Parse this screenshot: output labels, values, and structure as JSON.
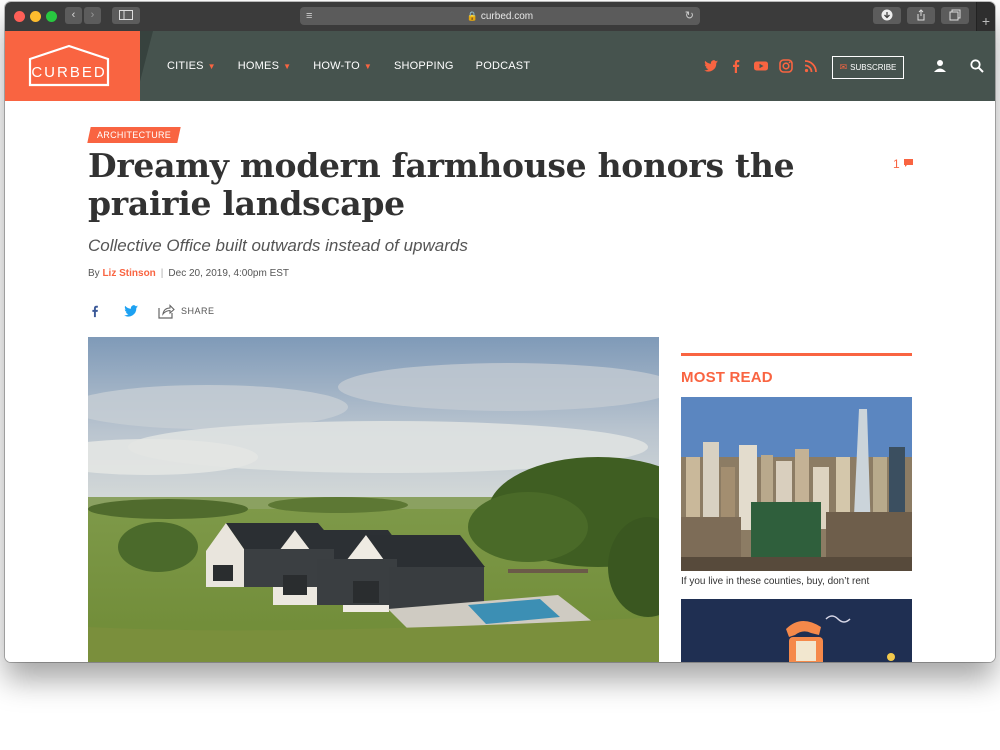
{
  "browser": {
    "url": "curbed.com",
    "lock_icon": "lock-icon"
  },
  "site": {
    "logo_text": "CURBED",
    "brand_color": "#f96441",
    "header_color": "#46534e",
    "nav": [
      {
        "label": "CITIES",
        "has_dropdown": true
      },
      {
        "label": "HOMES",
        "has_dropdown": true
      },
      {
        "label": "HOW-TO",
        "has_dropdown": true
      },
      {
        "label": "SHOPPING",
        "has_dropdown": false
      },
      {
        "label": "PODCAST",
        "has_dropdown": false
      }
    ],
    "social_icons": [
      "twitter-icon",
      "facebook-icon",
      "youtube-icon",
      "instagram-icon",
      "rss-icon"
    ],
    "subscribe_label": "SUBSCRIBE"
  },
  "article": {
    "tag": "ARCHITECTURE",
    "title": "Dreamy modern farmhouse honors the prairie landscape",
    "comment_count": "1",
    "subtitle": "Collective Office built outwards instead of upwards",
    "byline_prefix": "By",
    "author": "Liz Stinson",
    "date": "Dec 20, 2019, 4:00pm EST",
    "share_label": "SHARE"
  },
  "sidebar": {
    "heading": "MOST READ",
    "items": [
      {
        "caption": "If you live in these counties, buy, don’t rent"
      },
      {
        "caption": ""
      }
    ]
  }
}
